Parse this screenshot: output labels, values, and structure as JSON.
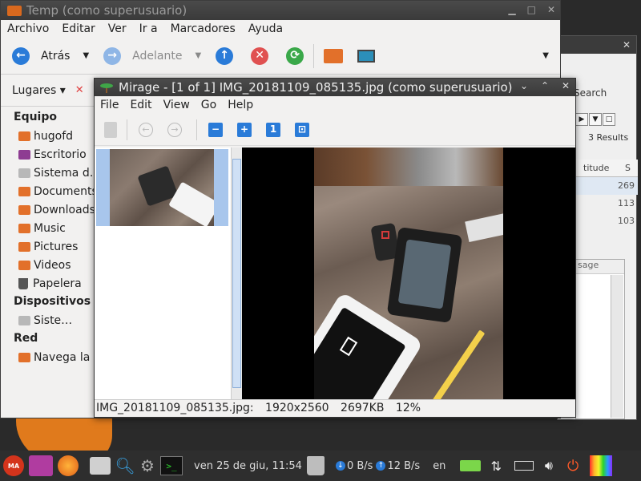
{
  "caja": {
    "title": "Temp (como superusuario)",
    "menu": [
      "Archivo",
      "Editar",
      "Ver",
      "Ir a",
      "Marcadores",
      "Ayuda"
    ],
    "toolbar": {
      "back": "Atrás",
      "forward": "Adelante"
    },
    "places_label": "Lugares",
    "sidebar": {
      "section_equipo": "Equipo",
      "equipo_items": [
        {
          "label": "hugofd",
          "icon": "folder-icon"
        },
        {
          "label": "Escritorio",
          "icon": "desktop-folder-icon"
        },
        {
          "label": "Sistema d…",
          "icon": "drive-icon"
        },
        {
          "label": "Documents",
          "icon": "folder-icon"
        },
        {
          "label": "Downloads",
          "icon": "folder-icon"
        },
        {
          "label": "Music",
          "icon": "folder-icon"
        },
        {
          "label": "Pictures",
          "icon": "folder-icon"
        },
        {
          "label": "Videos",
          "icon": "folder-icon"
        },
        {
          "label": "Papelera",
          "icon": "trash-icon"
        }
      ],
      "section_dispositivos": "Dispositivos",
      "dispositivos_items": [
        {
          "label": "Siste…",
          "icon": "drive-icon"
        }
      ],
      "section_red": "Red",
      "red_items": [
        {
          "label": "Navega la …",
          "icon": "network-folder-icon"
        }
      ]
    }
  },
  "back_window": {
    "search_label": "Search",
    "results_label": "3  Results",
    "column_header": "titude",
    "column_header_s": "S",
    "rows": [
      "269",
      "113",
      "103"
    ],
    "message_header": "sage"
  },
  "mirage": {
    "title": "Mirage - [1 of 1] IMG_20181109_085135.jpg (como superusuario)",
    "menu": [
      "File",
      "Edit",
      "View",
      "Go",
      "Help"
    ],
    "status": {
      "filename": "IMG_20181109_085135.jpg:",
      "dimensions": "1920x2560",
      "size": "2697KB",
      "zoom": "12%"
    }
  },
  "taskbar": {
    "clock": "ven 25 de giu, 11:54",
    "down_speed": "0 B/s",
    "up_speed": "12 B/s",
    "lang": "en",
    "mate_label": "MA"
  },
  "colors": {
    "accent_blue": "#2a7bd8",
    "folder_orange": "#e2702a",
    "power_orange": "#ff5a28"
  }
}
